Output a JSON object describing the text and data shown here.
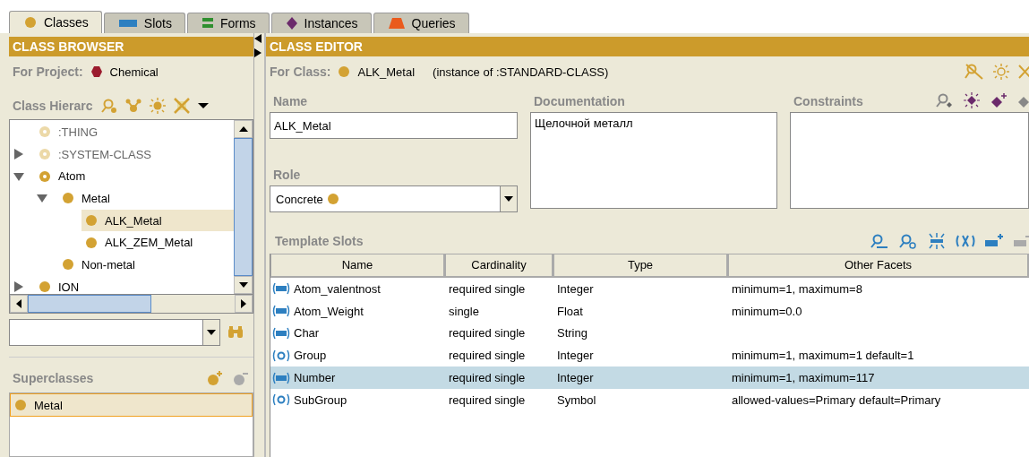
{
  "tabs": [
    {
      "label": "Classes",
      "selected": true
    },
    {
      "label": "Slots",
      "selected": false
    },
    {
      "label": "Forms",
      "selected": false
    },
    {
      "label": "Instances",
      "selected": false
    },
    {
      "label": "Queries",
      "selected": false
    }
  ],
  "class_browser": {
    "title": "CLASS BROWSER",
    "project_label": "For Project:",
    "project": "Chemical",
    "hierarchy_label": "Class Hierarc",
    "tree": [
      {
        "label": ":THING",
        "kind": "system",
        "selected": false
      },
      {
        "label": ":SYSTEM-CLASS",
        "kind": "system",
        "expanded": false,
        "selected": false
      },
      {
        "label": "Atom",
        "kind": "abstract",
        "expanded": true,
        "selected": false,
        "children": [
          {
            "label": "Metal",
            "kind": "concrete",
            "expanded": true,
            "selected": false,
            "children": [
              {
                "label": "ALK_Metal",
                "kind": "concrete",
                "selected": true
              },
              {
                "label": "ALK_ZEM_Metal",
                "kind": "concrete",
                "selected": false
              }
            ]
          },
          {
            "label": "Non-metal",
            "kind": "concrete",
            "selected": false
          }
        ]
      },
      {
        "label": "ION",
        "kind": "concrete",
        "expanded": false,
        "selected": false
      }
    ],
    "superclasses_label": "Superclasses",
    "superclasses": [
      {
        "label": "Metal",
        "selected": true
      }
    ]
  },
  "class_editor": {
    "title": "CLASS EDITOR",
    "class_label": "For Class:",
    "class_name": "ALK_Metal",
    "instance_of": "(instance of :STANDARD-CLASS)",
    "name_label": "Name",
    "name": "ALK_Metal",
    "documentation_label": "Documentation",
    "documentation": "Щелочной металл",
    "constraints_label": "Constraints",
    "role_label": "Role",
    "role": "Concrete",
    "template_slots_label": "Template Slots",
    "columns": [
      "Name",
      "Cardinality",
      "Type",
      "Other Facets"
    ],
    "slots": [
      {
        "kind": "own",
        "name": "Atom_valentnost",
        "cardinality": "required single",
        "type": "Integer",
        "facets": "minimum=1, maximum=8",
        "selected": false
      },
      {
        "kind": "own",
        "name": "Atom_Weight",
        "cardinality": "single",
        "type": "Float",
        "facets": "minimum=0.0",
        "selected": false
      },
      {
        "kind": "own",
        "name": "Char",
        "cardinality": "required single",
        "type": "String",
        "selected": false
      },
      {
        "kind": "overridden",
        "name": "Group",
        "cardinality": "required single",
        "type": "Integer",
        "facets": "minimum=1, maximum=1 default=1",
        "selected": false
      },
      {
        "kind": "own",
        "name": "Number",
        "cardinality": "required single",
        "type": "Integer",
        "facets": "minimum=1, maximum=117",
        "selected": true
      },
      {
        "kind": "overridden",
        "name": "SubGroup",
        "cardinality": "required single",
        "type": "Symbol",
        "facets": "allowed-values=Primary default=Primary",
        "selected": false
      }
    ]
  }
}
